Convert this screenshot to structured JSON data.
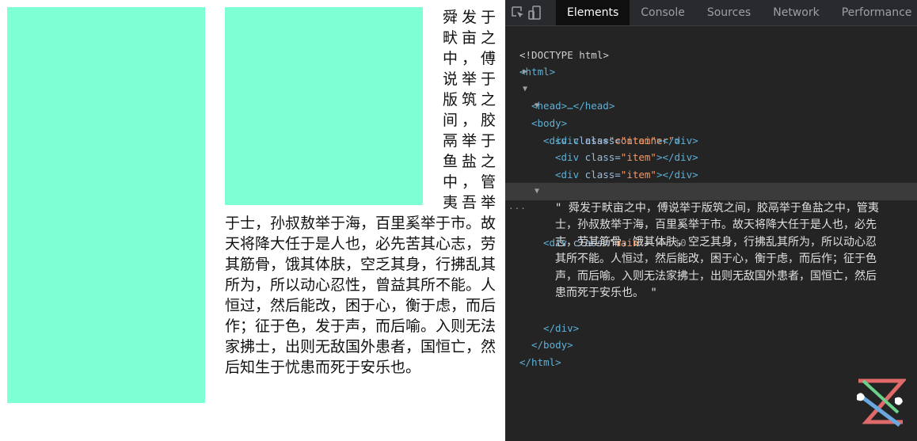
{
  "page": {
    "text": "舜发于畎亩之中，傅说举于版筑之间，胶鬲举于鱼盐之中，管夷吾举于士，孙叔敖举于海，百里奚举于市。故天将降大任于是人也，必先苦其心志，劳其筋骨，饿其体肤，空乏其身，行拂乱其所为，所以动心忍性，曾益其所不能。人恒过，然后能改，困于心，衡于虑，而后作；征于色，发于声，而后喻。入则无法家拂士，出则无敌国外患者，国恒亡，然后知生于忧患而死于安乐也。",
    "block_color": "#7fffd4"
  },
  "devtools": {
    "tabs": [
      "Elements",
      "Console",
      "Sources",
      "Network",
      "Performance"
    ],
    "active_tab": "Elements",
    "icons": [
      "inspect-element-icon",
      "device-toggle-icon"
    ],
    "tree": {
      "doctype": "<!DOCTYPE html>",
      "html_open": "<html>",
      "head": "<head>…</head>",
      "body_open": "<body>",
      "container_open_tag": "<div ",
      "container_attr": "class=",
      "container_val": "\"container\"",
      "item_tag_open": "<div ",
      "item_attr": "class=",
      "item_val": "\"item\"",
      "item_tag_close": "></div>",
      "div_close": "</div>",
      "main_tag_open": "<div ",
      "main_attr": "class=",
      "main_val": "\"main\"",
      "main_suffix": "> == $0",
      "text_lines": [
        "\" 舜发于畎亩之中，傅说举于版筑之间，胶鬲举于鱼盐之中，管夷",
        "士，孙叔敖举于海，百里奚举于市。故天将降大任于是人也，必先",
        "志，劳其筋骨，饿其体肤，空乏其身，行拂乱其所为，所以动心忍",
        "其所不能。人恒过，然后能改，困于心，衡于虑，而后作；征于色",
        "声，而后喻。入则无法家拂士，出则无敌国外患者，国恒亡，然后",
        "患而死于安乐也。 \""
      ],
      "body_close": "</body>",
      "html_close": "</html>"
    },
    "selected_marker": "···"
  },
  "colors": {
    "tag": "#5db0d7",
    "attr": "#9bbbdc",
    "val": "#f29766",
    "devtools_bg": "#242424"
  }
}
